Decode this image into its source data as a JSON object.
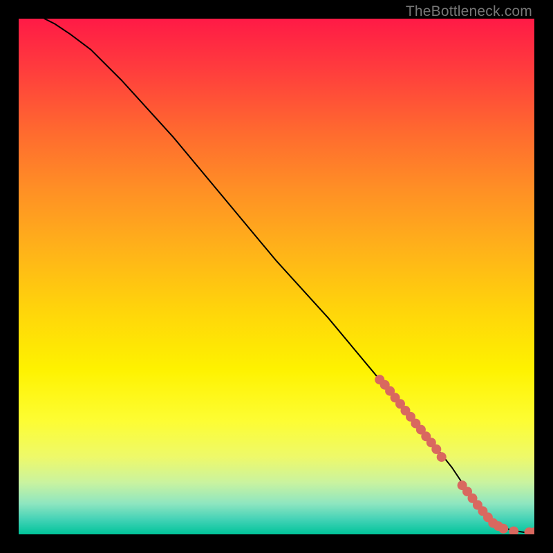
{
  "watermark": "TheBottleneck.com",
  "chart_data": {
    "type": "line",
    "title": "",
    "xlabel": "",
    "ylabel": "",
    "xlim": [
      0,
      100
    ],
    "ylim": [
      0,
      100
    ],
    "grid": false,
    "series": [
      {
        "name": "curve",
        "style": "line",
        "color": "#000000",
        "x": [
          5,
          7,
          10,
          14,
          20,
          30,
          40,
          50,
          60,
          70,
          76,
          80,
          84,
          86,
          88,
          90,
          92,
          94,
          96,
          98,
          100
        ],
        "y": [
          100,
          99,
          97,
          94,
          88,
          77,
          65,
          53,
          42,
          30,
          23,
          18,
          13,
          10,
          7,
          4.5,
          2.5,
          1.3,
          0.7,
          0.4,
          0.4
        ]
      },
      {
        "name": "highlighted-points",
        "style": "scatter",
        "color": "#d9685f",
        "x": [
          70,
          71,
          72,
          73,
          74,
          75,
          76,
          77,
          78,
          79,
          80,
          81,
          82,
          86,
          87,
          88,
          89,
          90,
          91,
          92,
          93,
          94,
          96,
          99,
          100
        ],
        "y": [
          30,
          29,
          27.8,
          26.5,
          25.3,
          24,
          22.8,
          21.5,
          20.3,
          19,
          17.8,
          16.5,
          15,
          9.5,
          8.3,
          7,
          5.7,
          4.5,
          3.3,
          2.2,
          1.6,
          1.1,
          0.6,
          0.4,
          0.4
        ]
      }
    ],
    "background": {
      "type": "vertical-gradient",
      "stops": [
        {
          "pos": 0,
          "color": "#ff1a46"
        },
        {
          "pos": 50,
          "color": "#ffd200"
        },
        {
          "pos": 100,
          "color": "#00c49a"
        }
      ]
    }
  }
}
